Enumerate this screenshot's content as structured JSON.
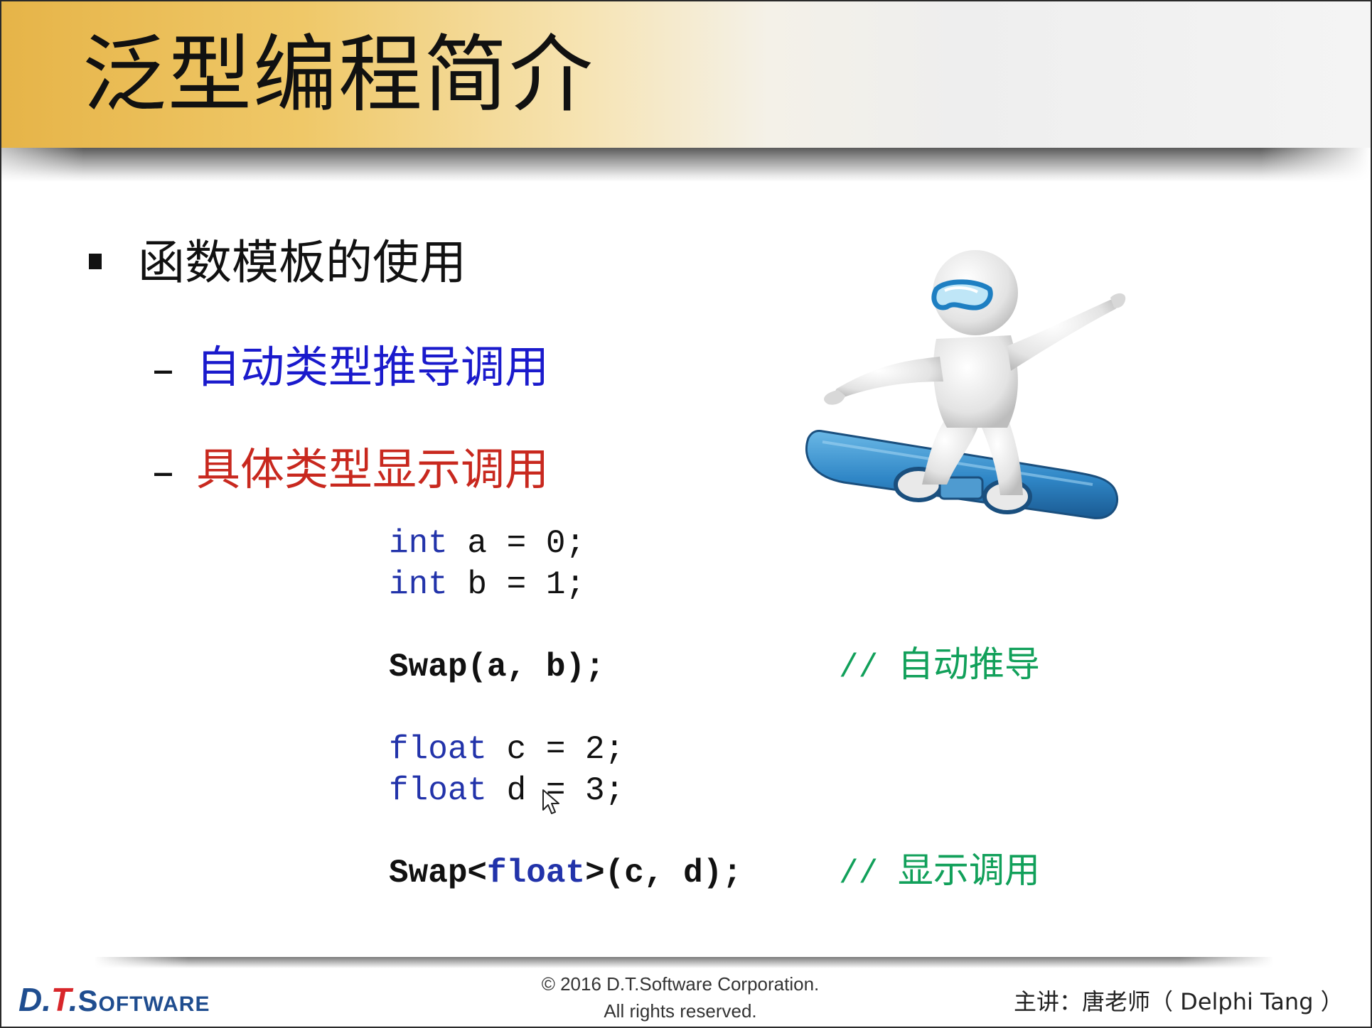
{
  "slide": {
    "title": "泛型编程简介",
    "bullet": "函数模板的使用",
    "sub_items": [
      {
        "dash": "–",
        "text": "自动类型推导调用",
        "color": "#1a1acc"
      },
      {
        "dash": "–",
        "text": "具体类型显示调用",
        "color": "#c8281e"
      }
    ],
    "code": {
      "line1": {
        "type": "int",
        "rest": " a = 0;"
      },
      "line2": {
        "type": "int",
        "rest": " b = 1;"
      },
      "line3": {
        "text": "Swap(a, b);"
      },
      "line4": {
        "type": "float",
        "rest": " c = 2;"
      },
      "line5": {
        "type": "float",
        "rest": " d = 3;"
      },
      "line6": {
        "pre": "Swap<",
        "type": "float",
        "post": ">(c, d);"
      }
    },
    "comments": [
      {
        "slashes": "// ",
        "text": "自动推导"
      },
      {
        "slashes": "// ",
        "text": "显示调用"
      }
    ]
  },
  "footer": {
    "logo": {
      "d": "D",
      "dot1": ".",
      "t": "T",
      "dot2": ".",
      "s": "S",
      "oftware": "OFTWARE"
    },
    "copyright_line1": "© 2016 D.T.Software Corporation.",
    "copyright_line2": "All rights reserved.",
    "lecturer": "主讲：唐老师（ Delphi Tang ）"
  },
  "colors": {
    "keyword": "#2233aa",
    "comment": "#11a05a",
    "header_gold": "#e6b448",
    "board_blue": "#2f86c6"
  },
  "icons": [
    "mouse-pointer-icon",
    "snowboarder-illustration"
  ]
}
